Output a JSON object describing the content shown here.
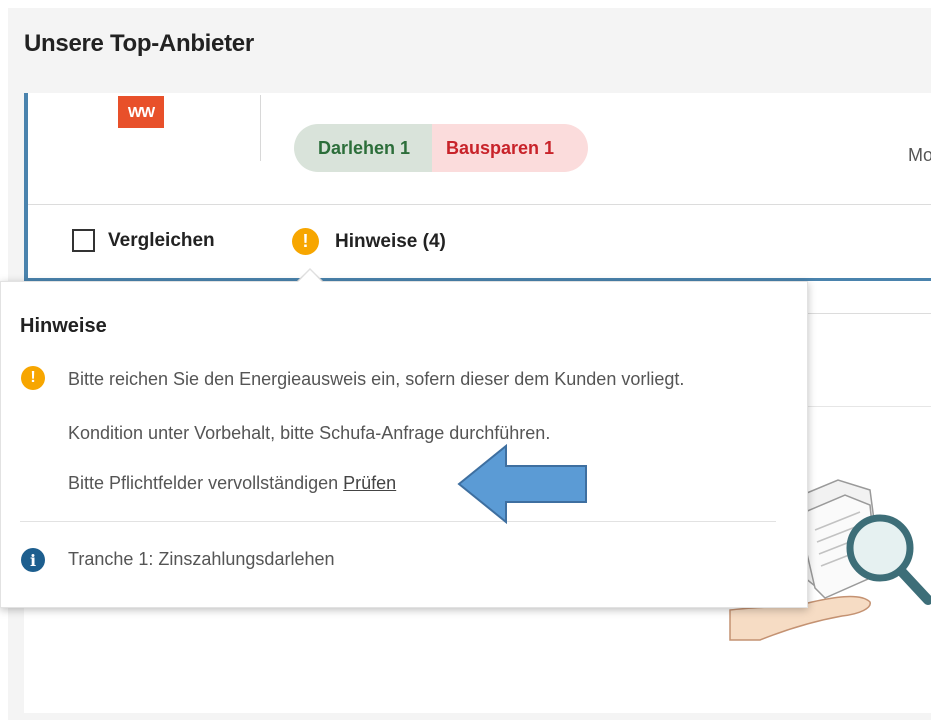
{
  "section": {
    "title": "Unsere Top-Anbieter"
  },
  "provider": {
    "logo_text": "WW",
    "tags": {
      "loan": "Darlehen 1",
      "savings": "Bausparen 1"
    },
    "truncated_text": "Mo"
  },
  "actions": {
    "compare_label": "Vergleichen",
    "notes_label": "Hinweise (4)"
  },
  "popover": {
    "title": "Hinweise",
    "items": [
      {
        "icon": "warning-icon",
        "text": "Bitte reichen Sie den Energieausweis ein, sofern dieser dem Kunden vorliegt."
      },
      {
        "icon": "",
        "text": "Kondition unter Vorbehalt, bitte Schufa-Anfrage durchführen."
      },
      {
        "icon": "",
        "text": "Bitte Pflichtfelder vervollständigen",
        "link": "Prüfen"
      },
      {
        "icon": "info-icon",
        "text": "Tranche 1: Zinszahlungsdarlehen"
      }
    ]
  },
  "colors": {
    "accent_blue": "#4a83ad",
    "warning": "#f7a600",
    "info": "#1d5e8e",
    "loan_bg": "#d9e3da",
    "loan_text": "#2c6e3a",
    "savings_bg": "#fbdcdc",
    "savings_text": "#c8232a",
    "logo_bg": "#e8502a",
    "annotation_arrow": "#5b9bd5"
  }
}
